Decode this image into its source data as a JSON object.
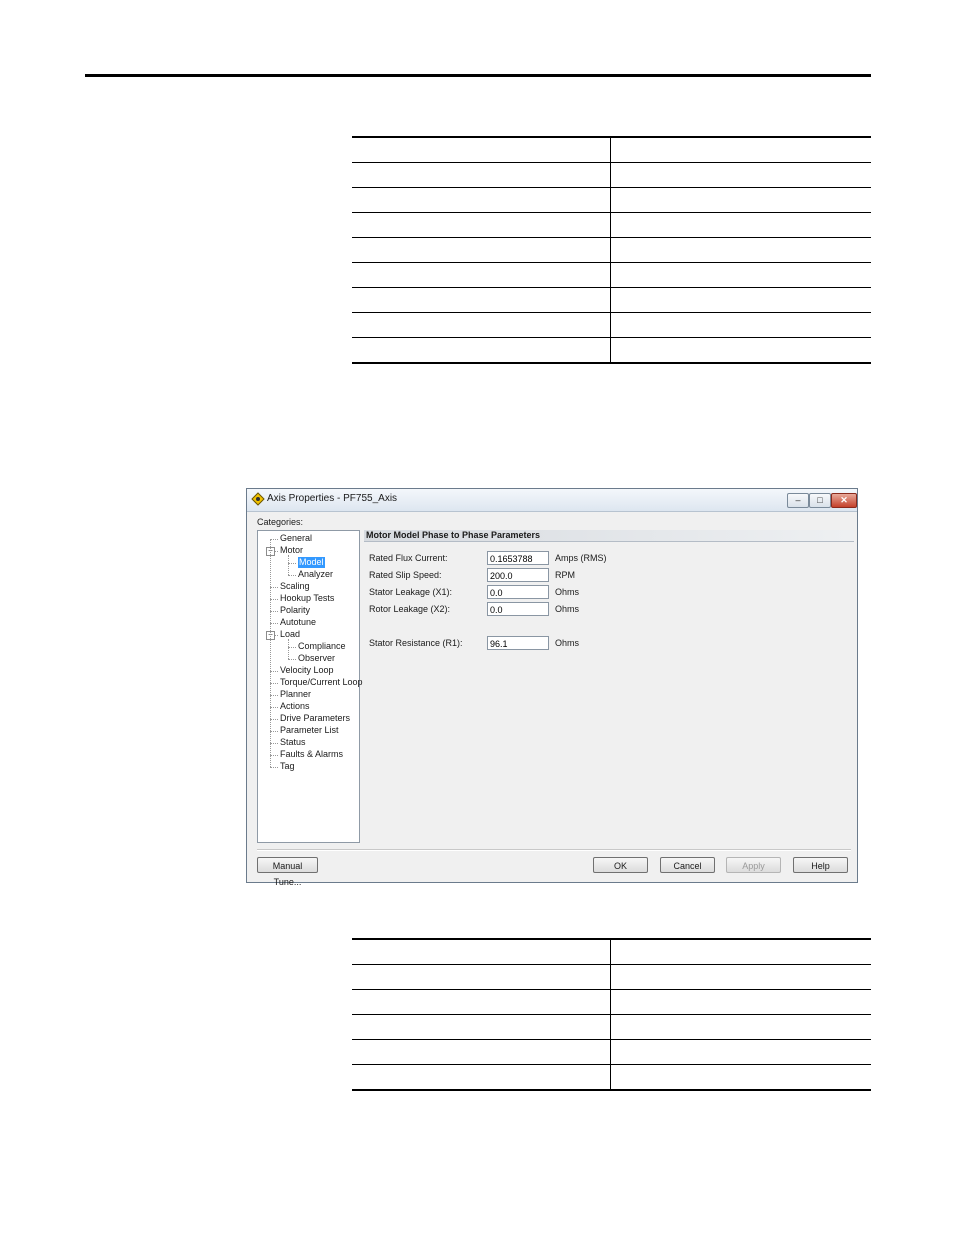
{
  "top_table": {
    "rows": [
      [
        "",
        ""
      ],
      [
        "",
        ""
      ],
      [
        "",
        ""
      ],
      [
        "",
        ""
      ],
      [
        "",
        ""
      ],
      [
        "",
        ""
      ],
      [
        "",
        ""
      ],
      [
        "",
        ""
      ],
      [
        "",
        ""
      ]
    ]
  },
  "dialog": {
    "title": "Axis Properties - PF755_Axis",
    "window_buttons": {
      "minimize": "–",
      "maximize": "□",
      "close": "✕"
    },
    "categories_label": "Categories:",
    "tree": [
      {
        "label": "General",
        "level": 0,
        "selected": false
      },
      {
        "label": "Motor",
        "level": 0,
        "selected": false,
        "expanded": true
      },
      {
        "label": "Model",
        "level": 1,
        "selected": true
      },
      {
        "label": "Analyzer",
        "level": 1,
        "selected": false
      },
      {
        "label": "Scaling",
        "level": 0,
        "selected": false
      },
      {
        "label": "Hookup Tests",
        "level": 0,
        "selected": false
      },
      {
        "label": "Polarity",
        "level": 0,
        "selected": false
      },
      {
        "label": "Autotune",
        "level": 0,
        "selected": false
      },
      {
        "label": "Load",
        "level": 0,
        "selected": false,
        "expanded": true
      },
      {
        "label": "Compliance",
        "level": 1,
        "selected": false
      },
      {
        "label": "Observer",
        "level": 1,
        "selected": false
      },
      {
        "label": "Velocity Loop",
        "level": 0,
        "selected": false
      },
      {
        "label": "Torque/Current Loop",
        "level": 0,
        "selected": false
      },
      {
        "label": "Planner",
        "level": 0,
        "selected": false
      },
      {
        "label": "Actions",
        "level": 0,
        "selected": false
      },
      {
        "label": "Drive Parameters",
        "level": 0,
        "selected": false
      },
      {
        "label": "Parameter List",
        "level": 0,
        "selected": false
      },
      {
        "label": "Status",
        "level": 0,
        "selected": false
      },
      {
        "label": "Faults & Alarms",
        "level": 0,
        "selected": false
      },
      {
        "label": "Tag",
        "level": 0,
        "selected": false
      }
    ],
    "section_header": "Motor Model Phase to Phase Parameters",
    "params": [
      {
        "label": "Rated Flux Current:",
        "value": "0.1653788",
        "unit": "Amps (RMS)"
      },
      {
        "label": "Rated Slip Speed:",
        "value": "200.0",
        "unit": "RPM"
      },
      {
        "label": "Stator Leakage (X1):",
        "value": "0.0",
        "unit": "Ohms"
      },
      {
        "label": "Rotor Leakage (X2):",
        "value": "0.0",
        "unit": "Ohms"
      },
      {
        "label": "Stator Resistance (R1):",
        "value": "96.1",
        "unit": "Ohms"
      }
    ],
    "buttons": {
      "manual_tune": "Manual Tune...",
      "ok": "OK",
      "cancel": "Cancel",
      "apply": "Apply",
      "help": "Help"
    }
  },
  "bottom_table": {
    "rows": [
      [
        "",
        ""
      ],
      [
        "",
        ""
      ],
      [
        "",
        ""
      ],
      [
        "",
        ""
      ],
      [
        "",
        ""
      ],
      [
        "",
        ""
      ]
    ]
  }
}
